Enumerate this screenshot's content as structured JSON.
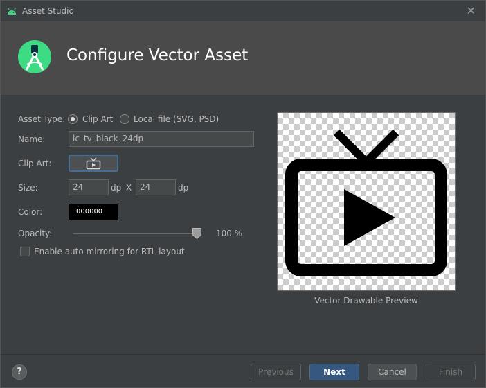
{
  "window": {
    "title": "Asset Studio",
    "close_icon": "close-icon"
  },
  "header": {
    "heading": "Configure Vector Asset",
    "logo_icon": "android-studio-logo"
  },
  "form": {
    "asset_type_label": "Asset Type:",
    "asset_type_options": [
      {
        "label": "Clip Art",
        "checked": true
      },
      {
        "label": "Local file (SVG, PSD)",
        "checked": false
      }
    ],
    "name_label": "Name:",
    "name_value": "ic_tv_black_24dp",
    "clip_art_label": "Clip Art:",
    "clip_art_icon": "tv-icon",
    "size_label": "Size:",
    "width_value": "24",
    "height_value": "24",
    "unit": "dp",
    "separator": "X",
    "color_label": "Color:",
    "color_value": "000000",
    "opacity_label": "Opacity:",
    "opacity_value": 100,
    "opacity_text": "100 %",
    "rtl_checkbox_label": "Enable auto mirroring for RTL layout",
    "rtl_checked": false
  },
  "preview": {
    "caption": "Vector Drawable Preview",
    "icon": "tv-icon"
  },
  "footer": {
    "help_label": "?",
    "previous_label": "Previous",
    "next_label": "Next",
    "cancel_label": "Cancel",
    "finish_label": "Finish"
  },
  "colors": {
    "background": "#3c3f41",
    "header_bg": "#4a4a4a",
    "accent_button": "#365880",
    "logo_green": "#3ddc84"
  }
}
